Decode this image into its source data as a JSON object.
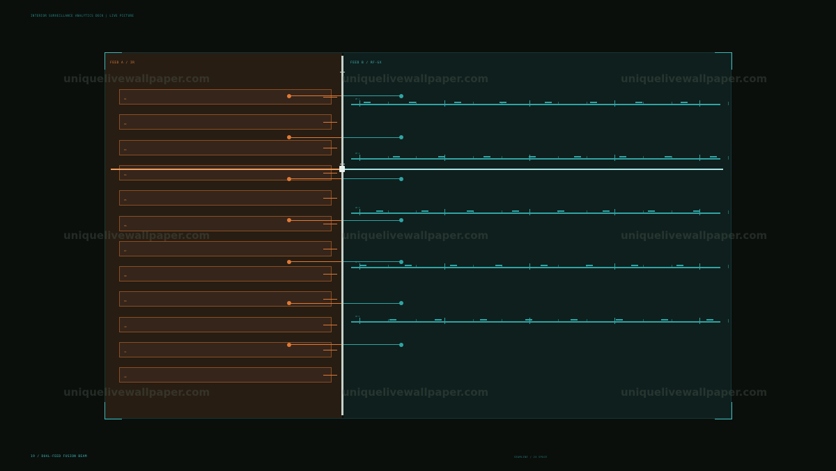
{
  "header": {
    "text": "INTERIOR SURVEILLANCE ANALYTICS DECK  |  LIVE PICTURE"
  },
  "footer": {
    "left": "19 / DUAL-FEED FUSION BEAM",
    "right": "SEAMLINE / 24 SPACE"
  },
  "panes": {
    "a": {
      "title": "FEED A / IR",
      "accent": "#e07a36"
    },
    "b": {
      "title": "FEED B / RF-GX",
      "accent": "#2fa5a5"
    }
  },
  "rows": [
    {
      "label": "01"
    },
    {
      "label": "02"
    },
    {
      "label": "03"
    },
    {
      "label": "04"
    },
    {
      "label": "05"
    },
    {
      "label": "06"
    },
    {
      "label": "07"
    },
    {
      "label": "08"
    },
    {
      "label": "09"
    },
    {
      "label": "10"
    },
    {
      "label": "11"
    },
    {
      "label": "12"
    }
  ],
  "tracks": [
    {
      "label": "CH 1"
    },
    {
      "label": "CH 2"
    },
    {
      "label": "CH 3"
    },
    {
      "label": "CH 4"
    },
    {
      "label": "CH 5"
    }
  ],
  "watermark": "uniquelivewallpaper.com"
}
